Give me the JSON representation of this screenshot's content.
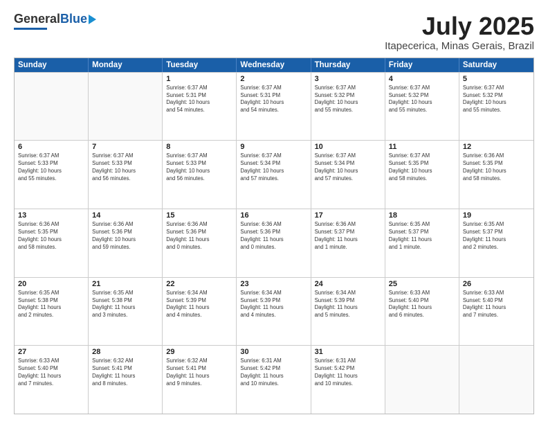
{
  "header": {
    "logo_general": "General",
    "logo_blue": "Blue",
    "title": "July 2025",
    "subtitle": "Itapecerica, Minas Gerais, Brazil"
  },
  "calendar": {
    "days": [
      "Sunday",
      "Monday",
      "Tuesday",
      "Wednesday",
      "Thursday",
      "Friday",
      "Saturday"
    ],
    "weeks": [
      [
        {
          "day": "",
          "detail": ""
        },
        {
          "day": "",
          "detail": ""
        },
        {
          "day": "1",
          "detail": "Sunrise: 6:37 AM\nSunset: 5:31 PM\nDaylight: 10 hours\nand 54 minutes."
        },
        {
          "day": "2",
          "detail": "Sunrise: 6:37 AM\nSunset: 5:31 PM\nDaylight: 10 hours\nand 54 minutes."
        },
        {
          "day": "3",
          "detail": "Sunrise: 6:37 AM\nSunset: 5:32 PM\nDaylight: 10 hours\nand 55 minutes."
        },
        {
          "day": "4",
          "detail": "Sunrise: 6:37 AM\nSunset: 5:32 PM\nDaylight: 10 hours\nand 55 minutes."
        },
        {
          "day": "5",
          "detail": "Sunrise: 6:37 AM\nSunset: 5:32 PM\nDaylight: 10 hours\nand 55 minutes."
        }
      ],
      [
        {
          "day": "6",
          "detail": "Sunrise: 6:37 AM\nSunset: 5:33 PM\nDaylight: 10 hours\nand 55 minutes."
        },
        {
          "day": "7",
          "detail": "Sunrise: 6:37 AM\nSunset: 5:33 PM\nDaylight: 10 hours\nand 56 minutes."
        },
        {
          "day": "8",
          "detail": "Sunrise: 6:37 AM\nSunset: 5:33 PM\nDaylight: 10 hours\nand 56 minutes."
        },
        {
          "day": "9",
          "detail": "Sunrise: 6:37 AM\nSunset: 5:34 PM\nDaylight: 10 hours\nand 57 minutes."
        },
        {
          "day": "10",
          "detail": "Sunrise: 6:37 AM\nSunset: 5:34 PM\nDaylight: 10 hours\nand 57 minutes."
        },
        {
          "day": "11",
          "detail": "Sunrise: 6:37 AM\nSunset: 5:35 PM\nDaylight: 10 hours\nand 58 minutes."
        },
        {
          "day": "12",
          "detail": "Sunrise: 6:36 AM\nSunset: 5:35 PM\nDaylight: 10 hours\nand 58 minutes."
        }
      ],
      [
        {
          "day": "13",
          "detail": "Sunrise: 6:36 AM\nSunset: 5:35 PM\nDaylight: 10 hours\nand 58 minutes."
        },
        {
          "day": "14",
          "detail": "Sunrise: 6:36 AM\nSunset: 5:36 PM\nDaylight: 10 hours\nand 59 minutes."
        },
        {
          "day": "15",
          "detail": "Sunrise: 6:36 AM\nSunset: 5:36 PM\nDaylight: 11 hours\nand 0 minutes."
        },
        {
          "day": "16",
          "detail": "Sunrise: 6:36 AM\nSunset: 5:36 PM\nDaylight: 11 hours\nand 0 minutes."
        },
        {
          "day": "17",
          "detail": "Sunrise: 6:36 AM\nSunset: 5:37 PM\nDaylight: 11 hours\nand 1 minute."
        },
        {
          "day": "18",
          "detail": "Sunrise: 6:35 AM\nSunset: 5:37 PM\nDaylight: 11 hours\nand 1 minute."
        },
        {
          "day": "19",
          "detail": "Sunrise: 6:35 AM\nSunset: 5:37 PM\nDaylight: 11 hours\nand 2 minutes."
        }
      ],
      [
        {
          "day": "20",
          "detail": "Sunrise: 6:35 AM\nSunset: 5:38 PM\nDaylight: 11 hours\nand 2 minutes."
        },
        {
          "day": "21",
          "detail": "Sunrise: 6:35 AM\nSunset: 5:38 PM\nDaylight: 11 hours\nand 3 minutes."
        },
        {
          "day": "22",
          "detail": "Sunrise: 6:34 AM\nSunset: 5:39 PM\nDaylight: 11 hours\nand 4 minutes."
        },
        {
          "day": "23",
          "detail": "Sunrise: 6:34 AM\nSunset: 5:39 PM\nDaylight: 11 hours\nand 4 minutes."
        },
        {
          "day": "24",
          "detail": "Sunrise: 6:34 AM\nSunset: 5:39 PM\nDaylight: 11 hours\nand 5 minutes."
        },
        {
          "day": "25",
          "detail": "Sunrise: 6:33 AM\nSunset: 5:40 PM\nDaylight: 11 hours\nand 6 minutes."
        },
        {
          "day": "26",
          "detail": "Sunrise: 6:33 AM\nSunset: 5:40 PM\nDaylight: 11 hours\nand 7 minutes."
        }
      ],
      [
        {
          "day": "27",
          "detail": "Sunrise: 6:33 AM\nSunset: 5:40 PM\nDaylight: 11 hours\nand 7 minutes."
        },
        {
          "day": "28",
          "detail": "Sunrise: 6:32 AM\nSunset: 5:41 PM\nDaylight: 11 hours\nand 8 minutes."
        },
        {
          "day": "29",
          "detail": "Sunrise: 6:32 AM\nSunset: 5:41 PM\nDaylight: 11 hours\nand 9 minutes."
        },
        {
          "day": "30",
          "detail": "Sunrise: 6:31 AM\nSunset: 5:42 PM\nDaylight: 11 hours\nand 10 minutes."
        },
        {
          "day": "31",
          "detail": "Sunrise: 6:31 AM\nSunset: 5:42 PM\nDaylight: 11 hours\nand 10 minutes."
        },
        {
          "day": "",
          "detail": ""
        },
        {
          "day": "",
          "detail": ""
        }
      ]
    ]
  }
}
